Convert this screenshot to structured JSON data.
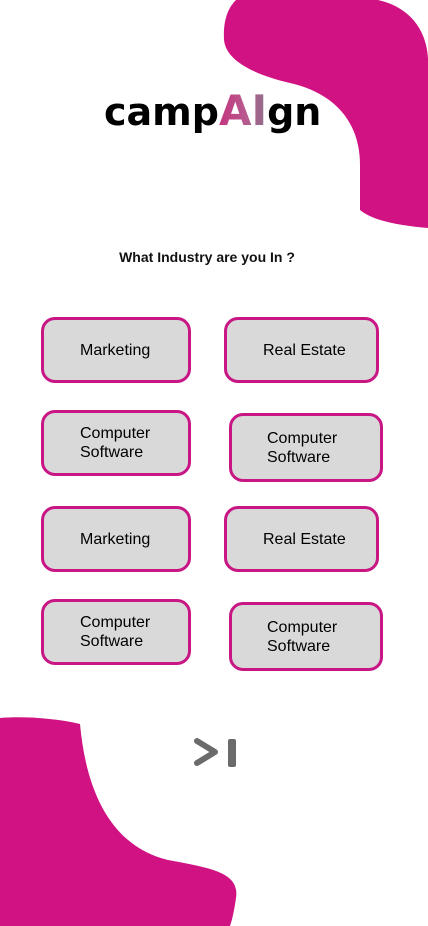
{
  "app": {
    "logo_prefix": "camp",
    "logo_ai": "AI",
    "logo_suffix": "gn"
  },
  "question": "What Industry are you In ?",
  "options": [
    {
      "line1": "Marketing",
      "line2": ""
    },
    {
      "line1": "Real Estate",
      "line2": ""
    },
    {
      "line1": "Computer",
      "line2": "Software"
    },
    {
      "line1": "Computer",
      "line2": "Software"
    },
    {
      "line1": "Marketing",
      "line2": ""
    },
    {
      "line1": "Real Estate",
      "line2": ""
    },
    {
      "line1": "Computer",
      "line2": "Software"
    },
    {
      "line1": "Computer",
      "line2": "Software"
    }
  ],
  "next_icon": "skip-to-end-icon",
  "colors": {
    "accent": "#d01283",
    "option_fill": "#d9d9d9",
    "option_border": "#c81684",
    "icon": "#6b6b6b"
  }
}
